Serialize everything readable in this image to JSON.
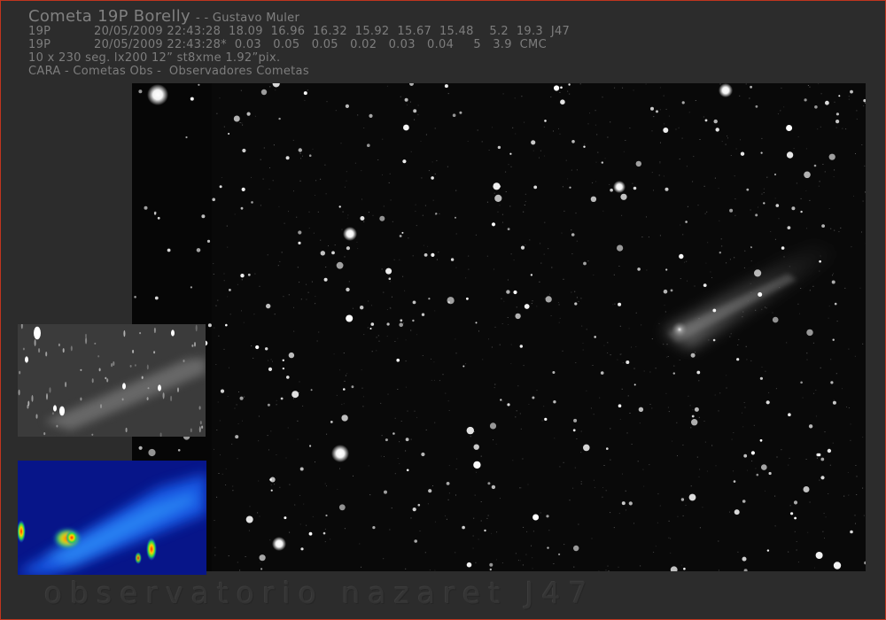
{
  "header": {
    "title": "Cometa 19P Borelly",
    "author": "- - Gustavo Muler",
    "line1": "19P           20/05/2009 22:43:28  18.09  16.96  16.32  15.92  15.67  15.48    5.2  19.3  J47",
    "line2": "19P           20/05/2009 22:43:28*  0.03   0.05   0.05   0.02   0.03   0.04     5   3.9  CMC",
    "line3": "10 x 230 seg. lx200 12” st8xme 1.92”pix.",
    "line4": "CARA - Cometas Obs -  Observadores Cometas"
  },
  "footer": {
    "watermark": "observatorio nazaret J47"
  },
  "colors": {
    "frame_border": "#c0351f",
    "background": "#2c2c2c",
    "text": "#7d7d7d",
    "false_color_base": "#0a1a9a"
  }
}
